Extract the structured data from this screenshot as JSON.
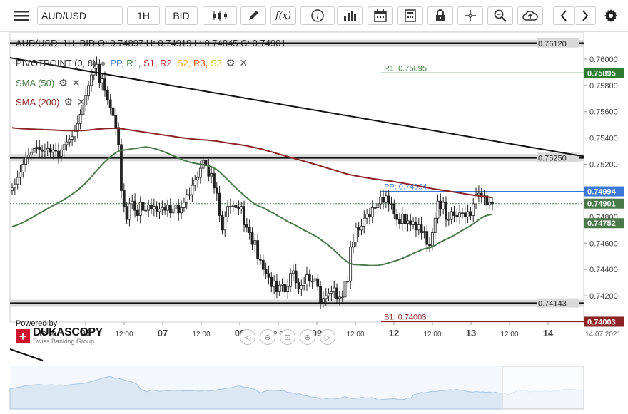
{
  "toolbar": {
    "symbol": "AUD/USD",
    "timeframe": "1H",
    "price_side": "BID",
    "fx_label": "f(x)",
    "info_label": "i"
  },
  "info_line": {
    "text": "AUD/USD, 1H, BID   O: 0.74897 H: 0.74919 L: 0.74845 C: 0.74901"
  },
  "indicators": {
    "pivot_label": "PIVOTPOINT (0, 8)",
    "pivot_levels": [
      {
        "name": "PP",
        "color": "#3c78d8"
      },
      {
        "name": "R1",
        "color": "#2e7d32"
      },
      {
        "name": "S1",
        "color": "#c62828"
      },
      {
        "name": "R2",
        "color": "#c62828"
      },
      {
        "name": "S2",
        "color": "#f0a000"
      },
      {
        "name": "R3",
        "color": "#e65100"
      },
      {
        "name": "S3",
        "color": "#d4c000"
      }
    ],
    "sma50_label": "SMA (50)",
    "sma50_color": "#4a7a4a",
    "sma200_label": "SMA (200)",
    "sma200_color": "#8b2323"
  },
  "branding": {
    "powered_by": "Powered by",
    "name": "DUKASCOPY",
    "tagline": "Swiss Banking Group"
  },
  "chart_data": {
    "type": "candlestick",
    "ylim": [
      0.74,
      0.762
    ],
    "y_ticks": [
      "0.76000",
      "0.75800",
      "0.75600",
      "0.75400",
      "0.75200",
      "0.74800",
      "0.74600",
      "0.74400",
      "0.74200"
    ],
    "x_ticks": [
      "12:00",
      "06",
      "12:00",
      "07",
      "12:00",
      "08",
      "12:00",
      "09",
      "12:00",
      "12",
      "12:00",
      "13",
      "12:00",
      "14"
    ],
    "date_label": "14.07.2021",
    "last_price": 0.74901,
    "price_labels": [
      {
        "value": "0.75895",
        "color": "#2e7d32"
      },
      {
        "value": "0.74994",
        "color": "#3c78d8"
      },
      {
        "value": "0.74901",
        "color": "#4a7a4a"
      },
      {
        "value": "0.74752",
        "color": "#4a7a4a"
      },
      {
        "value": "0.74003",
        "color": "#8b2323"
      }
    ],
    "lines": {
      "R1": {
        "label": "R1: 0.75895",
        "value": 0.75895
      },
      "PP": {
        "label": "PP: 0.74994",
        "value": 0.74994
      },
      "S1": {
        "label": "S1: 0.74003",
        "value": 0.74003
      }
    },
    "horizontal_levels": [
      {
        "label": "0.76120",
        "value": 0.7612
      },
      {
        "label": "0.75250",
        "value": 0.7525
      },
      {
        "label": "0.74143",
        "value": 0.74143
      }
    ],
    "trendline": {
      "from": [
        0,
        0.7601
      ],
      "to": [
        1,
        0.7526
      ]
    },
    "closes": [
      0.7502,
      0.7505,
      0.751,
      0.7514,
      0.752,
      0.7525,
      0.7527,
      0.7529,
      0.7532,
      0.7533,
      0.7531,
      0.753,
      0.7531,
      0.7532,
      0.7529,
      0.7531,
      0.753,
      0.7526,
      0.7531,
      0.7535,
      0.7537,
      0.7539,
      0.7541,
      0.7545,
      0.7551,
      0.7558,
      0.7565,
      0.7572,
      0.758,
      0.7588,
      0.7593,
      0.7596,
      0.7582,
      0.7585,
      0.7576,
      0.7569,
      0.7563,
      0.7557,
      0.7548,
      0.7535,
      0.75,
      0.7488,
      0.7478,
      0.749,
      0.7492,
      0.7485,
      0.7481,
      0.7491,
      0.7485,
      0.7485,
      0.7489,
      0.7486,
      0.7488,
      0.7484,
      0.7486,
      0.7487,
      0.7485,
      0.7489,
      0.7483,
      0.7486,
      0.7489,
      0.7483,
      0.7487,
      0.7491,
      0.7497,
      0.7497,
      0.7504,
      0.7508,
      0.751,
      0.7517,
      0.7523,
      0.7519,
      0.7511,
      0.7513,
      0.7502,
      0.7498,
      0.7481,
      0.747,
      0.748,
      0.7488,
      0.7488,
      0.7489,
      0.7487,
      0.7486,
      0.7488,
      0.7474,
      0.7472,
      0.7468,
      0.7459,
      0.7462,
      0.7448,
      0.7447,
      0.744,
      0.7437,
      0.7434,
      0.7427,
      0.7431,
      0.7423,
      0.7428,
      0.7429,
      0.7423,
      0.7427,
      0.7437,
      0.7439,
      0.743,
      0.7425,
      0.7428,
      0.7429,
      0.7436,
      0.7431,
      0.7431,
      0.7433,
      0.7427,
      0.7415,
      0.7418,
      0.742,
      0.7422,
      0.7423,
      0.7426,
      0.7418,
      0.7419,
      0.7419,
      0.7431,
      0.7431,
      0.7457,
      0.7461,
      0.7472,
      0.747,
      0.7473,
      0.7479,
      0.7482,
      0.748,
      0.7487,
      0.7487,
      0.749,
      0.7495,
      0.7491,
      0.7496,
      0.749,
      0.749,
      0.7482,
      0.7478,
      0.7475,
      0.7482,
      0.7475,
      0.7477,
      0.7474,
      0.7476,
      0.747,
      0.7474,
      0.7468,
      0.7469,
      0.7459,
      0.7458,
      0.7468,
      0.7479,
      0.7492,
      0.7486,
      0.7491,
      0.7478,
      0.7478,
      0.7484,
      0.7481,
      0.748,
      0.7483,
      0.7483,
      0.748,
      0.7484,
      0.7481,
      0.749,
      0.7497,
      0.7498,
      0.7495,
      0.7496,
      0.7489,
      0.7491,
      0.749
    ],
    "series": [
      {
        "name": "SMA (50)",
        "color": "#4a7a4a"
      },
      {
        "name": "SMA (200)",
        "color": "#8b2323"
      }
    ]
  }
}
